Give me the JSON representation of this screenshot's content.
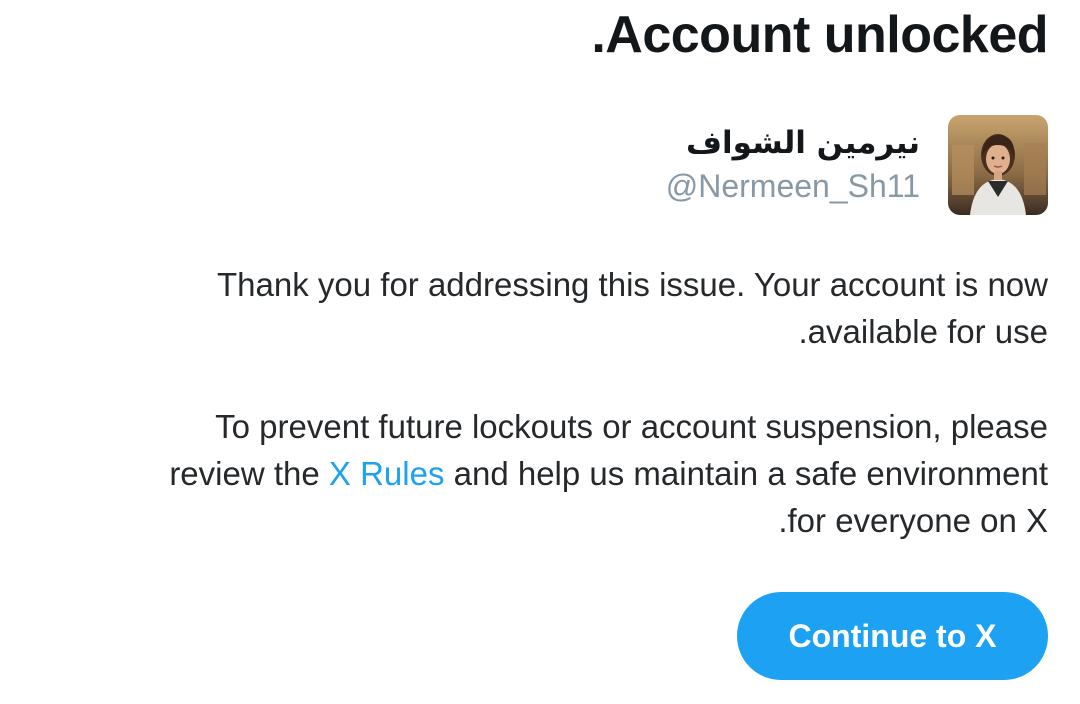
{
  "title": ".Account unlocked",
  "profile": {
    "display_name": "نيرمين الشواف",
    "handle": "@Nermeen_Sh11"
  },
  "message": {
    "paragraph1": {
      "line1": "Thank you for addressing this issue. Your account is now",
      "line2": ".available for use"
    },
    "paragraph2": {
      "line1": "To prevent future lockouts or account suspension, please",
      "line2_before": "review the ",
      "link": "X Rules",
      "line2_after": " and help us maintain a safe environment",
      "line3": ".for everyone on X"
    }
  },
  "continue_button": "Continue to X",
  "colors": {
    "accent": "#1da1f2",
    "text": "#14171a",
    "muted": "#8899a6"
  }
}
